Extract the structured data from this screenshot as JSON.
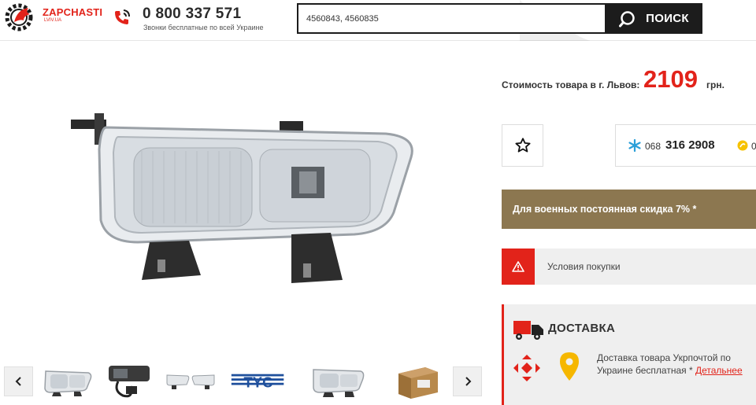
{
  "header": {
    "logo_text": "ZAPCHASTI",
    "logo_sub": "LVIV.UA",
    "phone_number": "0 800 337 571",
    "phone_subtitle": "Звонки бесплатные по всей Украине",
    "search_value": "4560843, 4560835",
    "search_button_label": "ПОИСК"
  },
  "product": {
    "thumbnails": [
      "fog-lamp",
      "wiring-harness",
      "fog-lamp-pair",
      "tyc-logo",
      "fog-lamp",
      "box"
    ],
    "thumbnail_logo_text": "TYC"
  },
  "pricing": {
    "label": "Стоимость товара в г. Львов:",
    "value": "2109",
    "currency": "грн."
  },
  "contacts": {
    "prefix": "068",
    "number": "316 2908",
    "extra": "0"
  },
  "military_banner": "Для военных постоянная скидка 7% *",
  "conditions_label": "Условия покупки",
  "delivery": {
    "title": "ДОСТАВКА",
    "text": "Доставка товара Укрпочтой по Украине бесплатная *",
    "link": "Детальнее"
  },
  "colors": {
    "accent": "#e2231a",
    "dark": "#1c1c1c",
    "banner": "#8c7750",
    "panel": "#efefef"
  }
}
